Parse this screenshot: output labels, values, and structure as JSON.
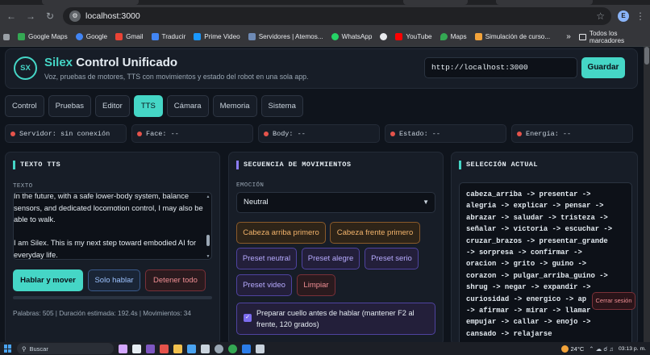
{
  "browser": {
    "url": "localhost:3000",
    "profile_initial": "E",
    "bookmarks": [
      {
        "label": "Google Maps",
        "color": "#34a853"
      },
      {
        "label": "Google",
        "color": "#4285f4"
      },
      {
        "label": "Gmail",
        "color": "#ea4335"
      },
      {
        "label": "Traducir",
        "color": "#4285f4"
      },
      {
        "label": "Prime Video",
        "color": "#1a98ff"
      },
      {
        "label": "Servidores | Atemos...",
        "color": "#6e8ab5"
      },
      {
        "label": "WhatsApp",
        "color": "#25d366"
      },
      {
        "label": "",
        "color": "#e8eaed"
      },
      {
        "label": "YouTube",
        "color": "#ff0000"
      },
      {
        "label": "Maps",
        "color": "#34a853"
      },
      {
        "label": "Simulación de curso...",
        "color": "#f2a33a"
      }
    ],
    "bookmarks_more": "»",
    "bookmarks_folder": "Todos los marcadores"
  },
  "header": {
    "logo": "SX",
    "title_accent": "Silex",
    "title_rest": " Control Unificado",
    "subtitle": "Voz, pruebas de motores, TTS con movimientos y estado del robot en una sola app.",
    "server_url": "http://localhost:3000",
    "save_label": "Guardar"
  },
  "tabs": [
    "Control",
    "Pruebas",
    "Editor",
    "TTS",
    "Cámara",
    "Memoria",
    "Sistema"
  ],
  "active_tab": "TTS",
  "status": [
    {
      "label": "Servidor: sin conexión"
    },
    {
      "label": "Face: --"
    },
    {
      "label": "Body: --"
    },
    {
      "label": "Estado: --"
    },
    {
      "label": "Energía: --"
    }
  ],
  "tts_panel": {
    "title": "TEXTO TTS",
    "field_label": "TEXTO",
    "text": "In the future, with a safe lower-body system, balance sensors, and dedicated locomotion control, I may also be able to walk.\n\nI am Silex. This is my next step toward embodied AI for everyday life.",
    "btn_speak_move": "Hablar y mover",
    "btn_speak_only": "Solo hablar",
    "btn_stop": "Detener todo",
    "progress": 0,
    "stats": "Palabras: 505 | Duración estimada: 192.4s | Movimientos: 34"
  },
  "sequence_panel": {
    "title": "SECUENCIA DE MOVIMIENTOS",
    "emotion_label": "EMOCIÓN",
    "emotion_value": "Neutral",
    "btn_head_up": "Cabeza arriba primero",
    "btn_head_front": "Cabeza frente primero",
    "btn_preset_neutral": "Preset neutral",
    "btn_preset_happy": "Preset alegre",
    "btn_preset_serious": "Preset serio",
    "btn_preset_video": "Preset video",
    "btn_clear": "Limpiar",
    "checkbox_label": "Preparar cuello antes de hablar (mantener F2 al frente, 120 grados)",
    "checkbox_checked": true
  },
  "selection_panel": {
    "title": "SELECCIÓN ACTUAL",
    "content": "cabeza_arriba -> presentar ->\nalegria -> explicar -> pensar ->\nabrazar -> saludar -> tristeza ->\nseñalar -> victoria -> escuchar ->\ncruzar_brazos -> presentar_grande\n-> sorpresa -> confirmar ->\noracion -> grito -> guino ->\ncorazon -> pulgar_arriba_guino ->\nshrug -> negar -> expandir ->\ncuriosidad -> energico -> ap\n-> afirmar -> mirar -> llamar\nempujar -> callar -> enojo ->\ncansado -> relajarse"
  },
  "toast": "Cerrar sesión",
  "taskbar": {
    "search_placeholder": "Buscar",
    "temperature": "24°C",
    "time": "03:13 p. m."
  }
}
